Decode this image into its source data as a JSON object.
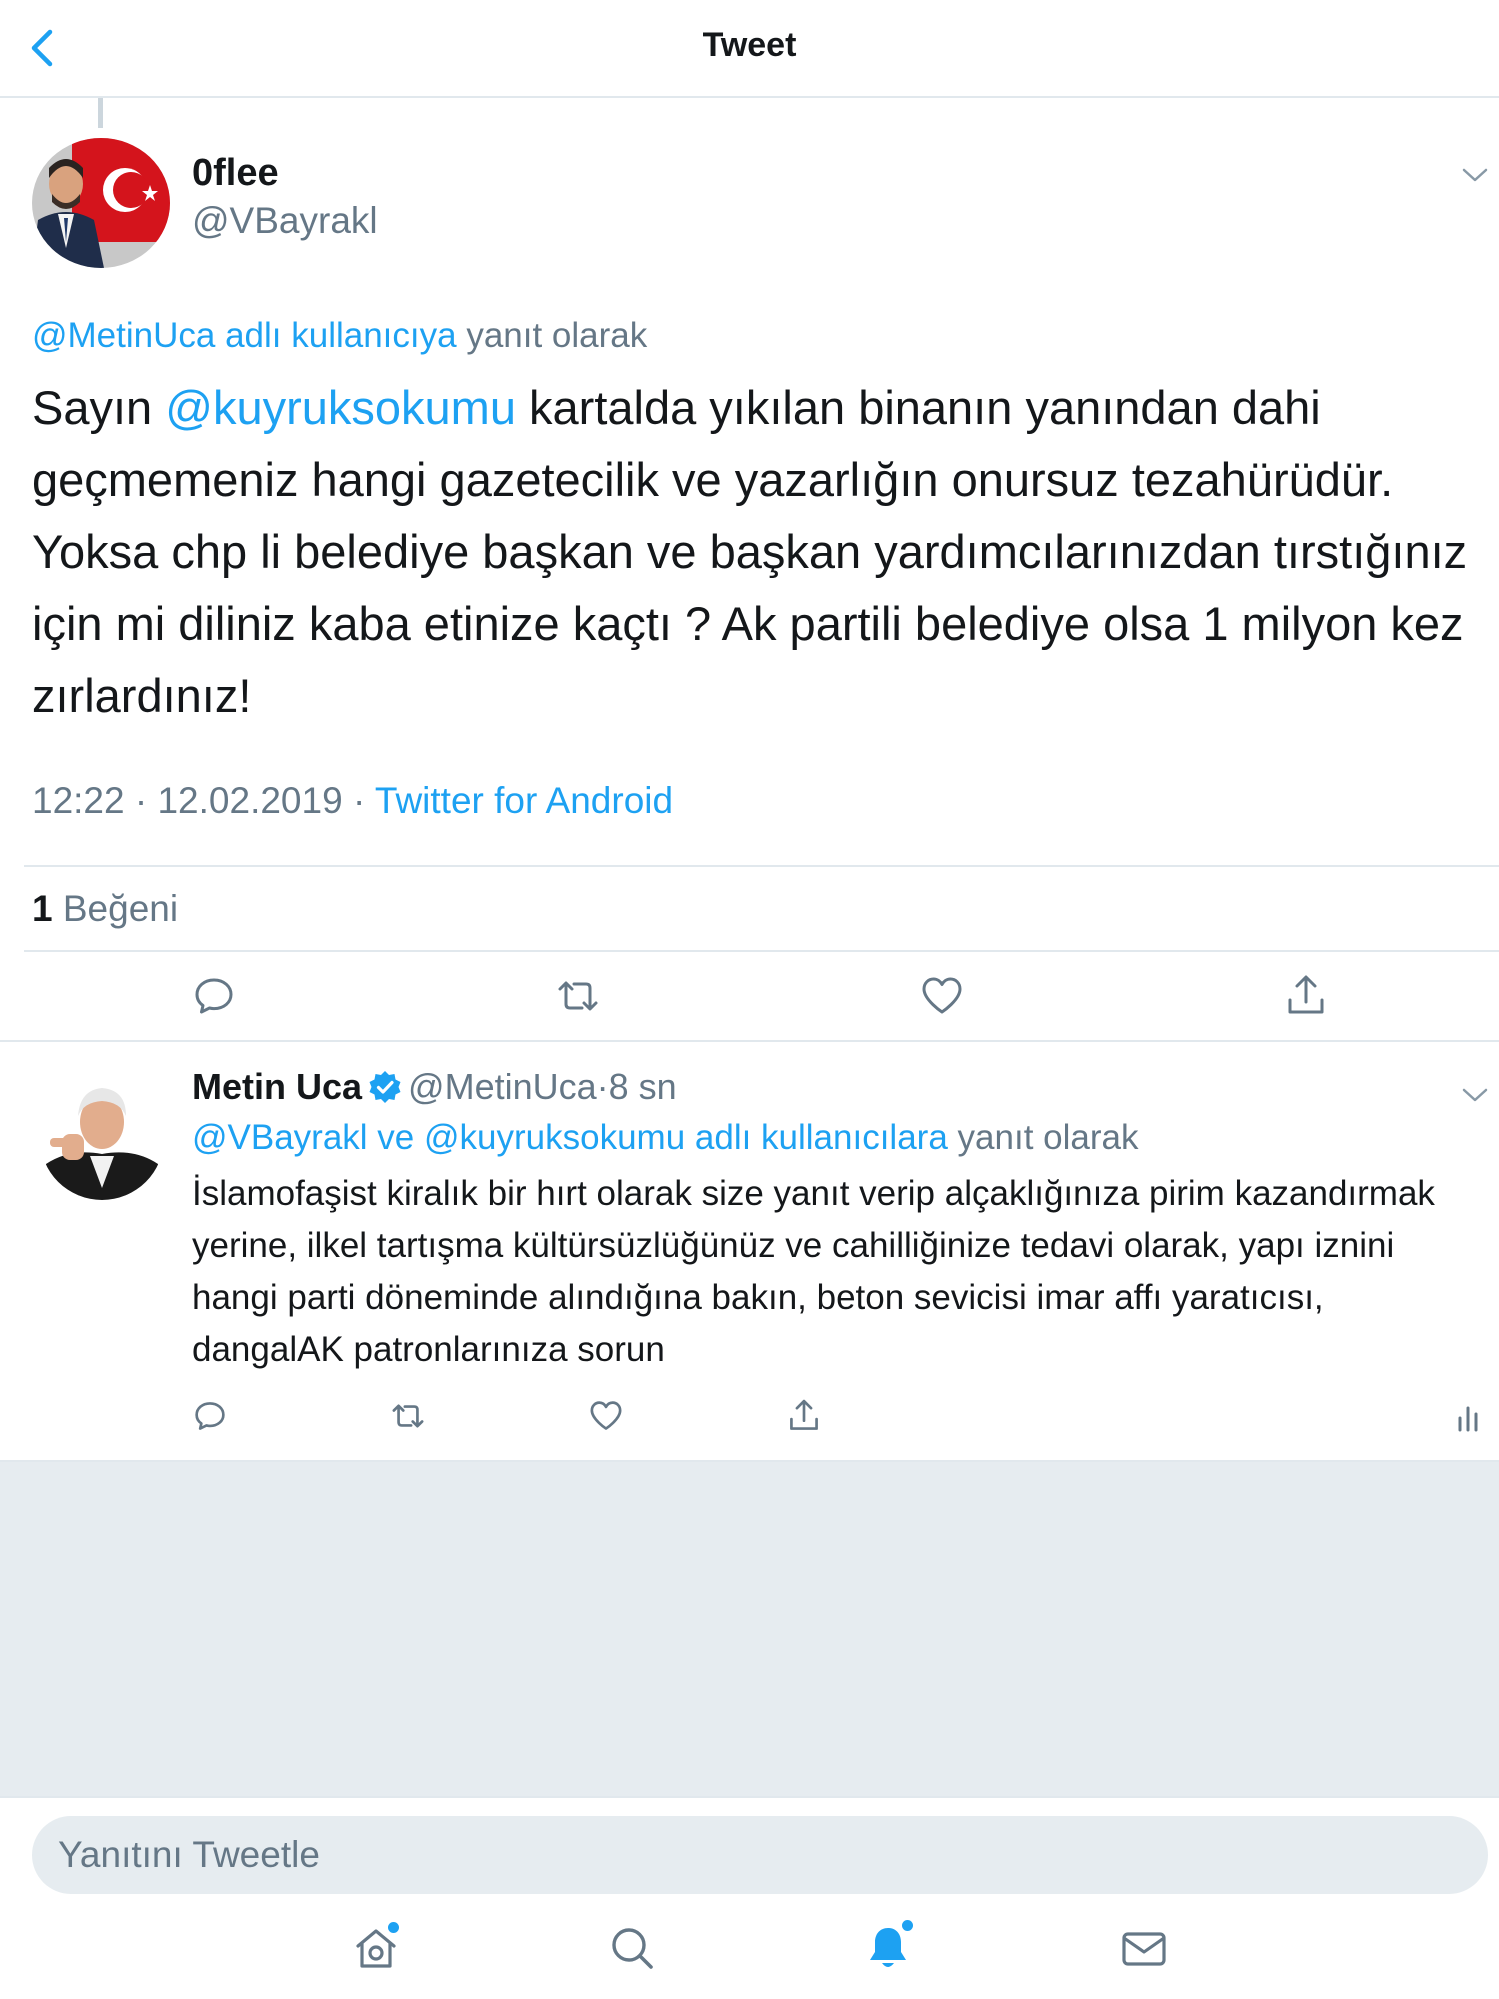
{
  "header": {
    "title": "Tweet"
  },
  "main_tweet": {
    "author_name": "0flee",
    "author_handle": "@VBayrakl",
    "reply_to_link": "@MetinUca adlı kullanıcıya",
    "reply_to_suffix": " yanıt olarak",
    "text_prefix": "Sayın ",
    "text_mention": "@kuyruksokumu",
    "text_body": " kartalda yıkılan binanın yanından dahi geçmemeniz hangi gazetecilik ve yazarlığın onursuz tezahürüdür. Yoksa chp li belediye başkan ve başkan yardımcılarınızdan tırstığınız için mi diliniz kaba etinize kaçtı ? Ak partili belediye olsa 1 milyon kez zırlardınız!",
    "time": "12:22",
    "date": "12.02.2019",
    "separator": " · ",
    "source": "Twitter for Android",
    "likes_count": "1",
    "likes_label": " Beğeni"
  },
  "reply_tweet": {
    "author_name": "Metin Uca",
    "author_handle": "@MetinUca",
    "time": "8 sn",
    "separator": "·",
    "reply_to_link": "@VBayrakl ve @kuyruksokumu adlı kullanıcılara",
    "reply_to_suffix": " yanıt olarak",
    "text": "İslamofaşist kiralık bir hırt olarak size yanıt verip alçaklığınıza pirim kazandırmak yerine,  ilkel tartışma kültürsüzlüğünüz ve cahilliğinize tedavi olarak, yapı iznini hangi parti döneminde alındığına bakın, beton sevicisi imar affı yaratıcısı, dangalAK patronlarınıza sorun"
  },
  "compose": {
    "placeholder": "Yanıtını Tweetle"
  },
  "colors": {
    "accent": "#1da1f2",
    "text": "#14171a",
    "muted": "#657786",
    "border": "#e1e8ed",
    "background_grey": "#e6ecf0"
  },
  "icons": {
    "back": "chevron-left-icon",
    "caret": "chevron-down-icon",
    "reply": "speech-bubble-icon",
    "retweet": "retweet-icon",
    "like": "heart-icon",
    "share": "share-icon",
    "analytics": "bar-chart-icon",
    "verified": "verified-badge-icon",
    "home": "home-icon",
    "search": "search-icon",
    "notifications": "bell-icon",
    "messages": "envelope-icon"
  }
}
